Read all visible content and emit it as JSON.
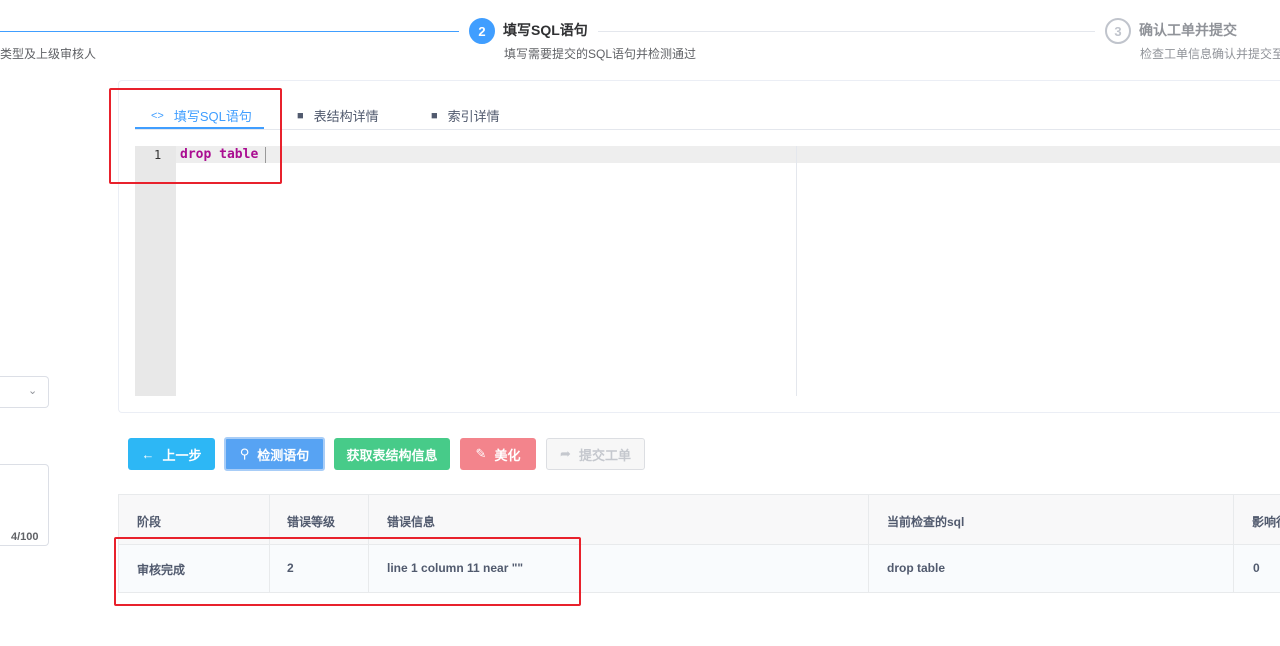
{
  "steps": [
    {
      "desc": "类型及上级审核人"
    },
    {
      "number": "2",
      "title": "填写SQL语句",
      "desc": "填写需要提交的SQL语句并检测通过"
    },
    {
      "number": "3",
      "title": "确认工单并提交",
      "desc": "检查工单信息确认并提交至"
    }
  ],
  "form": {
    "textarea_count": "4/100"
  },
  "tabs": [
    {
      "icon": "code-icon",
      "label": "填写SQL语句"
    },
    {
      "icon": "folder-icon",
      "label": "表结构详情"
    },
    {
      "icon": "folder-icon",
      "label": "索引详情"
    }
  ],
  "editor": {
    "line_number": "1",
    "code": "drop table "
  },
  "buttons": {
    "prev": "上一步",
    "check": "检测语句",
    "get_struct": "获取表结构信息",
    "beautify": "美化",
    "submit": "提交工单"
  },
  "table": {
    "headers": [
      "阶段",
      "错误等级",
      "错误信息",
      "当前检查的sql",
      "影响行"
    ],
    "rows": [
      [
        "审核完成",
        "2",
        "line 1 column 11 near \"\"",
        "drop table",
        "0"
      ]
    ]
  },
  "colors": {
    "primary": "#409eff",
    "highlight": "#e8212c"
  }
}
